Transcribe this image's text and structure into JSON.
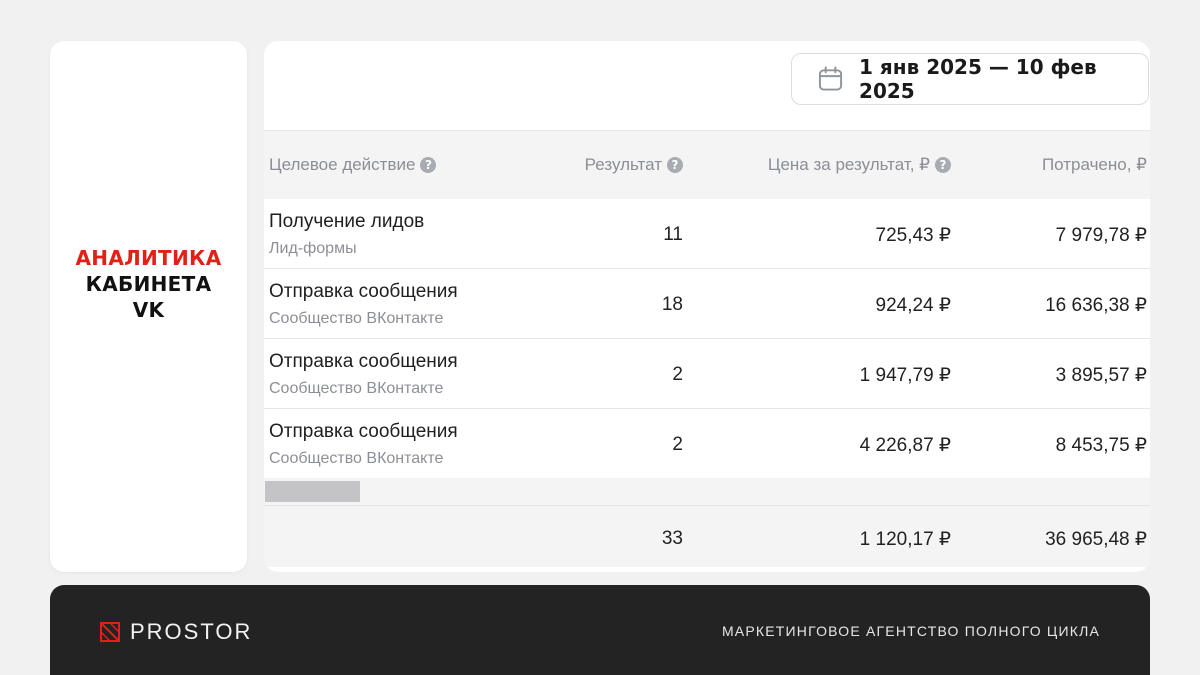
{
  "sidebar": {
    "title_line1": "АНАЛИТИКА",
    "title_line2": "КАБИНЕТА",
    "title_line3": "VK"
  },
  "toolbar": {
    "date_range": "1 янв 2025 — 10 фев 2025",
    "icon": "calendar-icon"
  },
  "table": {
    "columns": [
      {
        "label": "Целевое действие",
        "help_icon": "question-icon"
      },
      {
        "label": "Результат",
        "help_icon": "question-icon"
      },
      {
        "label": "Цена за результат, ₽",
        "help_icon": "question-icon"
      },
      {
        "label": "Потрачено, ₽"
      }
    ],
    "rows": [
      {
        "action": "Получение лидов",
        "source": "Лид-формы",
        "result": "11",
        "price": "725,43 ₽",
        "spent": "7 979,78 ₽"
      },
      {
        "action": "Отправка сообщения",
        "source": "Сообщество ВКонтакте",
        "result": "18",
        "price": "924,24 ₽",
        "spent": "16 636,38 ₽"
      },
      {
        "action": "Отправка сообщения",
        "source": "Сообщество ВКонтакте",
        "result": "2",
        "price": "1 947,79 ₽",
        "spent": "3 895,57 ₽"
      },
      {
        "action": "Отправка сообщения",
        "source": "Сообщество ВКонтакте",
        "result": "2",
        "price": "4 226,87 ₽",
        "spent": "8 453,75 ₽"
      }
    ],
    "totals": {
      "result": "33",
      "price": "1 120,17 ₽",
      "spent": "36 965,48 ₽"
    }
  },
  "footer": {
    "logo_text": "PROSTOR",
    "tagline": "МАРКЕТИНГОВОЕ АГЕНТСТВО ПОЛНОГО ЦИКЛА"
  },
  "colors": {
    "accent_red": "#e32018",
    "footer_bg": "#232323",
    "background": "#f1f1f1"
  }
}
